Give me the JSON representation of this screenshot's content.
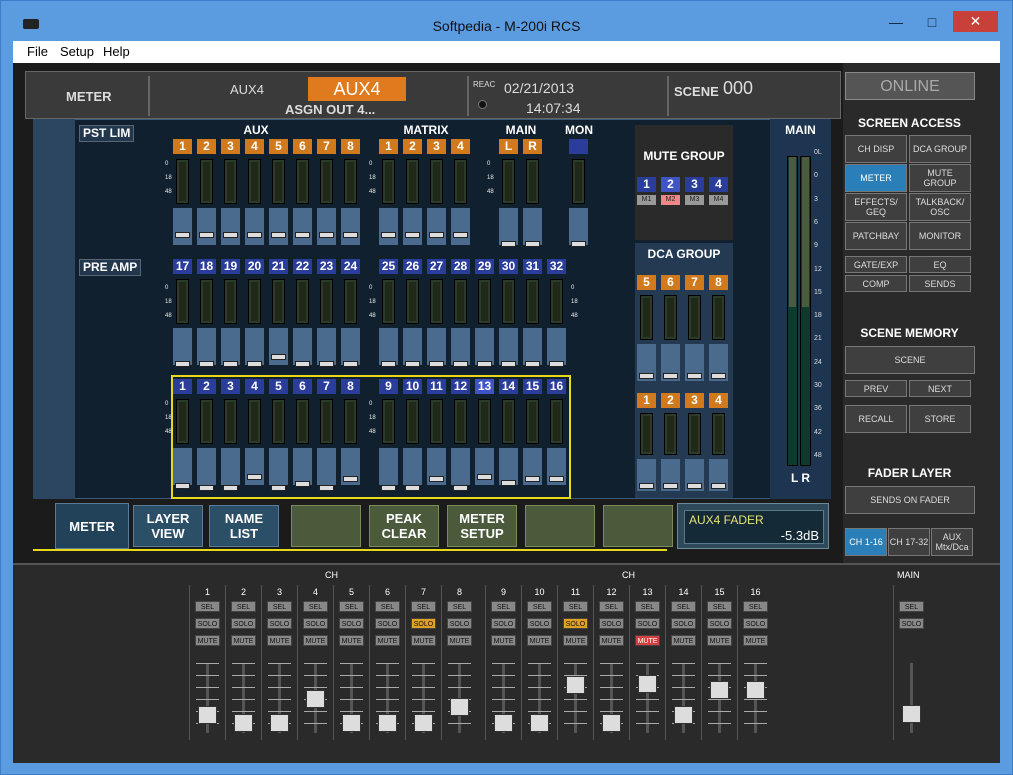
{
  "window": {
    "title": "Softpedia - M-200i RCS"
  },
  "menu": [
    "File",
    "Setup",
    "Help"
  ],
  "top": {
    "meter_label": "METER",
    "aux_label": "AUX4",
    "aux_name": "AUX4",
    "assign": "ASGN OUT 4...",
    "reac": "REAC",
    "date": "02/21/2013",
    "time": "14:07:34",
    "scene_label": "SCENE",
    "scene_num": "000"
  },
  "online": "ONLINE",
  "screen_access": {
    "head": "SCREEN ACCESS",
    "buttons": [
      "CH DISP",
      "DCA GROUP",
      "METER",
      "MUTE GROUP",
      "EFFECTS/ GEQ",
      "TALKBACK/ OSC",
      "PATCHBAY",
      "MONITOR",
      "GATE/EXP",
      "EQ",
      "COMP",
      "SENDS"
    ],
    "active": "METER"
  },
  "scene_memory": {
    "head": "SCENE MEMORY",
    "scene": "SCENE",
    "prev": "PREV",
    "next": "NEXT",
    "recall": "RECALL",
    "store": "STORE"
  },
  "fader_layer": {
    "head": "FADER LAYER",
    "sends": "SENDS ON FADER",
    "layers": [
      "CH 1-16",
      "CH 17-32",
      "AUX Mtx/Dca"
    ],
    "active": "CH 1-16"
  },
  "meter": {
    "pst_lim": "PST LIM",
    "pre_amp": "PRE AMP",
    "aux_head": "AUX",
    "matrix_head": "MATRIX",
    "main_head": "MAIN",
    "mon_head": "MON",
    "aux": [
      "1",
      "2",
      "3",
      "4",
      "5",
      "6",
      "7",
      "8"
    ],
    "matrix": [
      "1",
      "2",
      "3",
      "4"
    ],
    "main": [
      "L",
      "R"
    ],
    "ch_top": [
      "17",
      "18",
      "19",
      "20",
      "21",
      "22",
      "23",
      "24",
      "25",
      "26",
      "27",
      "28",
      "29",
      "30",
      "31",
      "32"
    ],
    "ch_bot": [
      "1",
      "2",
      "3",
      "4",
      "5",
      "6",
      "7",
      "8",
      "9",
      "10",
      "11",
      "12",
      "13",
      "14",
      "15",
      "16"
    ],
    "scale": [
      "0",
      "18",
      "48"
    ],
    "mute_group_head": "MUTE GROUP",
    "mute_groups": [
      "1",
      "2",
      "3",
      "4"
    ],
    "mute_tags": [
      "M1",
      "M2",
      "M3",
      "M4"
    ],
    "dca_group_head": "DCA GROUP",
    "dca_top": [
      "5",
      "6",
      "7",
      "8"
    ],
    "dca_bot": [
      "1",
      "2",
      "3",
      "4"
    ],
    "main_meter": {
      "title": "MAIN",
      "lr": "L R",
      "ticks": [
        "0L",
        "0",
        "3",
        "6",
        "9",
        "12",
        "15",
        "18",
        "21",
        "24",
        "30",
        "36",
        "42",
        "48"
      ]
    }
  },
  "tabs": [
    "METER",
    "LAYER VIEW",
    "NAME LIST",
    "",
    "PEAK CLEAR",
    "METER SETUP",
    "",
    ""
  ],
  "aux_fader": {
    "label": "AUX4 FADER",
    "value": "-5.3dB"
  },
  "lower": {
    "ch_head": "CH",
    "main_head": "MAIN",
    "channels": [
      "1",
      "2",
      "3",
      "4",
      "5",
      "6",
      "7",
      "8",
      "9",
      "10",
      "11",
      "12",
      "13",
      "14",
      "15",
      "16"
    ],
    "sel": "SEL",
    "solo": "SOLO",
    "mute": "MUTE",
    "solo_active": [
      "7",
      "11"
    ],
    "mute_active": [
      "13"
    ]
  }
}
